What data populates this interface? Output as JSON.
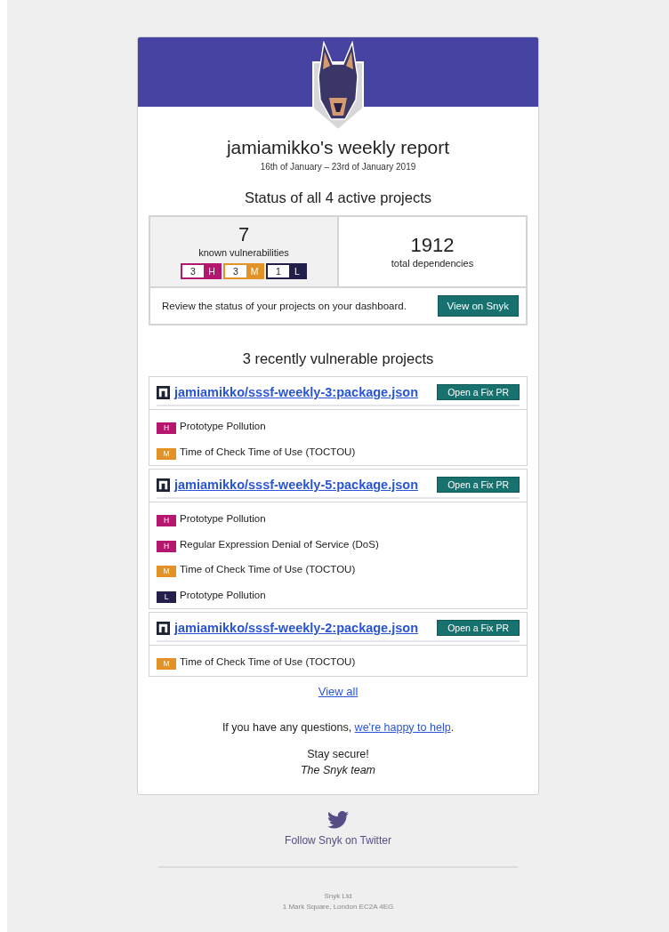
{
  "header": {
    "title": "jamiamikko's weekly report",
    "date_range": "16th of January – 23rd of January 2019"
  },
  "status": {
    "heading": "Status of all 4 active projects",
    "vulnerabilities": {
      "count": "7",
      "label": "known vulnerabilities",
      "severities": [
        {
          "count": "3",
          "letter": "H",
          "color": "#b5176e"
        },
        {
          "count": "3",
          "letter": "M",
          "color": "#e39227"
        },
        {
          "count": "1",
          "letter": "L",
          "color": "#22204a"
        }
      ]
    },
    "dependencies": {
      "count": "1912",
      "label": "total dependencies"
    },
    "review_text": "Review the status of your projects on your dashboard.",
    "button": "View on Snyk"
  },
  "recent": {
    "heading": "3 recently vulnerable projects",
    "projects": [
      {
        "name": "jamiamikko/sssf-weekly-3:package.json",
        "button": "Open a Fix PR",
        "issues": [
          {
            "letter": "H",
            "color": "#b5176e",
            "title": "Prototype Pollution"
          },
          {
            "letter": "M",
            "color": "#e39227",
            "title": "Time of Check Time of Use (TOCTOU)"
          }
        ]
      },
      {
        "name": "jamiamikko/sssf-weekly-5:package.json",
        "button": "Open a Fix PR",
        "issues": [
          {
            "letter": "H",
            "color": "#b5176e",
            "title": "Prototype Pollution"
          },
          {
            "letter": "H",
            "color": "#b5176e",
            "title": "Regular Expression Denial of Service (DoS)"
          },
          {
            "letter": "M",
            "color": "#e39227",
            "title": "Time of Check Time of Use (TOCTOU)"
          },
          {
            "letter": "L",
            "color": "#22204a",
            "title": "Prototype Pollution"
          }
        ]
      },
      {
        "name": "jamiamikko/sssf-weekly-2:package.json",
        "button": "Open a Fix PR",
        "issues": [
          {
            "letter": "M",
            "color": "#e39227",
            "title": "Time of Check Time of Use (TOCTOU)"
          }
        ]
      }
    ],
    "view_all": "View all"
  },
  "closing": {
    "question": "If you have any questions, ",
    "link": "we're happy to help",
    "after": ".",
    "sign_off": "Stay secure!",
    "team": "The Snyk team"
  },
  "footer": {
    "twitter": "Follow Snyk on Twitter",
    "company": "Snyk Ltd",
    "address": "1 Mark Square, London EC2A 4EG"
  }
}
